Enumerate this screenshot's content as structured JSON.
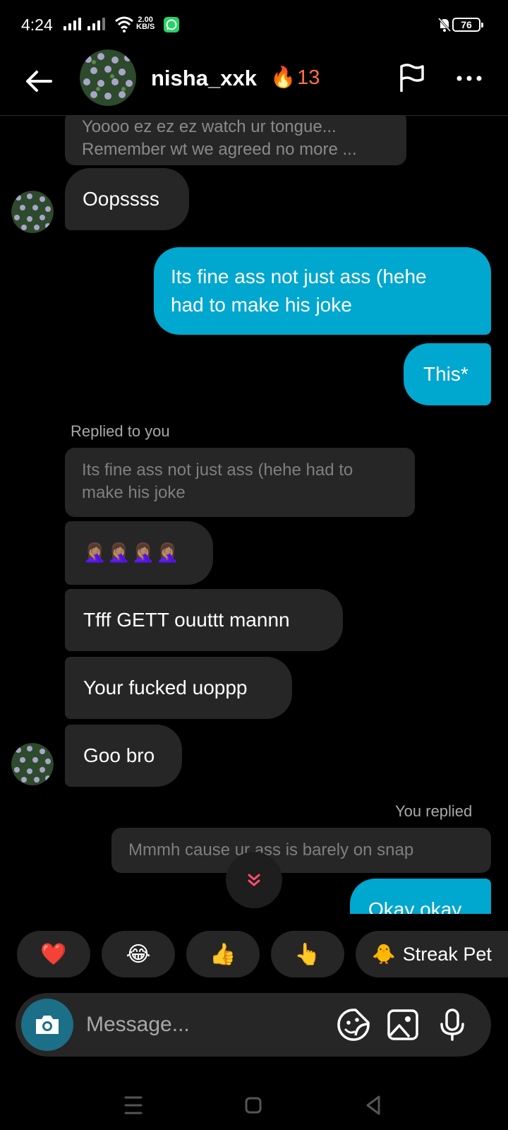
{
  "status_bar": {
    "time": "4:24",
    "net_speed_value": "2.00",
    "net_speed_unit": "KB/S",
    "battery": "76"
  },
  "header": {
    "username": "nisha_xxk",
    "streak_count": "13"
  },
  "messages": {
    "quoted_top_line1": "Yoooo ez ez ez watch ur tongue...",
    "quoted_top_line2": "Remember wt we agreed no more ...",
    "m1": "Oopssss",
    "m2_line1": "Its fine ass not just ass (hehe",
    "m2_line2": "had to make his joke",
    "m3": "This*",
    "replied_label": "Replied to you",
    "quote2_line1": "Its fine ass not just ass (hehe had to",
    "quote2_line2": "make his joke",
    "m4_emoji": "🤦🏽‍♀️🤦🏽‍♀️🤦🏽‍♀️🤦🏽‍♀️",
    "m5": "Tfff GETT ouuttt mannn",
    "m6": "Your fucked uoppp",
    "m7": "Goo bro",
    "you_replied_label": "You replied",
    "quote3": "Mmmh cause ur ass is  barely on snap",
    "m8": "Okay okay"
  },
  "reactions": {
    "r1": "❤️",
    "r2": "😂",
    "r3": "👍",
    "r4": "👆",
    "r5_icon": "🐥",
    "r5_label": "Streak Pet"
  },
  "composer": {
    "placeholder": "Message..."
  },
  "colors": {
    "outgoing_bubble": "#00a7cf",
    "incoming_bubble": "#262626",
    "streak": "#ff7043"
  }
}
